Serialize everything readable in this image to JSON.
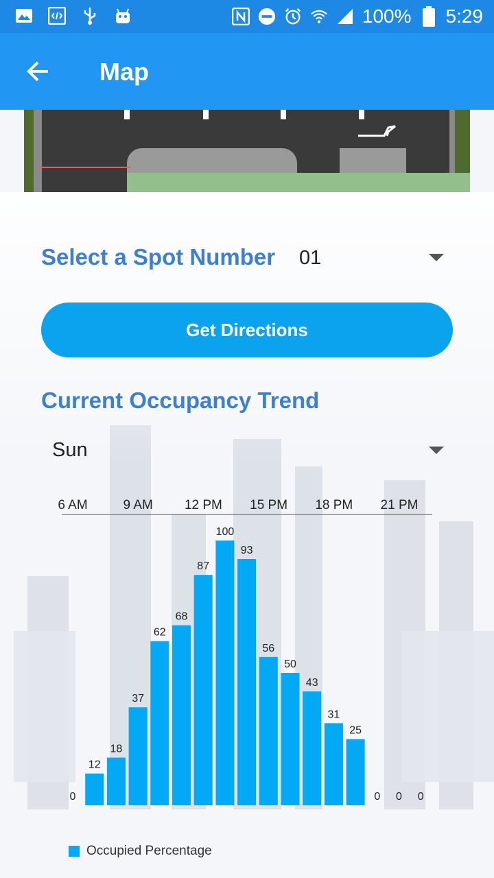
{
  "status_bar": {
    "battery": "100%",
    "time": "5:29",
    "icons": [
      "image-icon",
      "code-icon",
      "usb-icon",
      "android-icon",
      "nfc-icon",
      "do-not-disturb-icon",
      "alarm-icon",
      "wifi-icon",
      "signal-icon",
      "battery-icon"
    ]
  },
  "app_bar": {
    "title": "Map",
    "back_icon": "arrow-left-icon"
  },
  "form": {
    "spot_label": "Select a Spot Number",
    "spot_value": "01",
    "directions_label": "Get Directions",
    "trend_title": "Current Occupancy Trend",
    "day_value": "Sun"
  },
  "chart_data": {
    "type": "bar",
    "x_tick_labels": [
      "6 AM",
      "9 AM",
      "12 PM",
      "15 PM",
      "18 PM",
      "21 PM"
    ],
    "values": [
      0,
      12,
      18,
      37,
      62,
      68,
      87,
      100,
      93,
      56,
      50,
      43,
      31,
      25,
      0,
      0,
      0
    ],
    "series": [
      {
        "name": "Occupied Percentage",
        "color": "#03a9f4"
      }
    ],
    "ylim": [
      0,
      100
    ],
    "legend_position": "bottom-left"
  }
}
